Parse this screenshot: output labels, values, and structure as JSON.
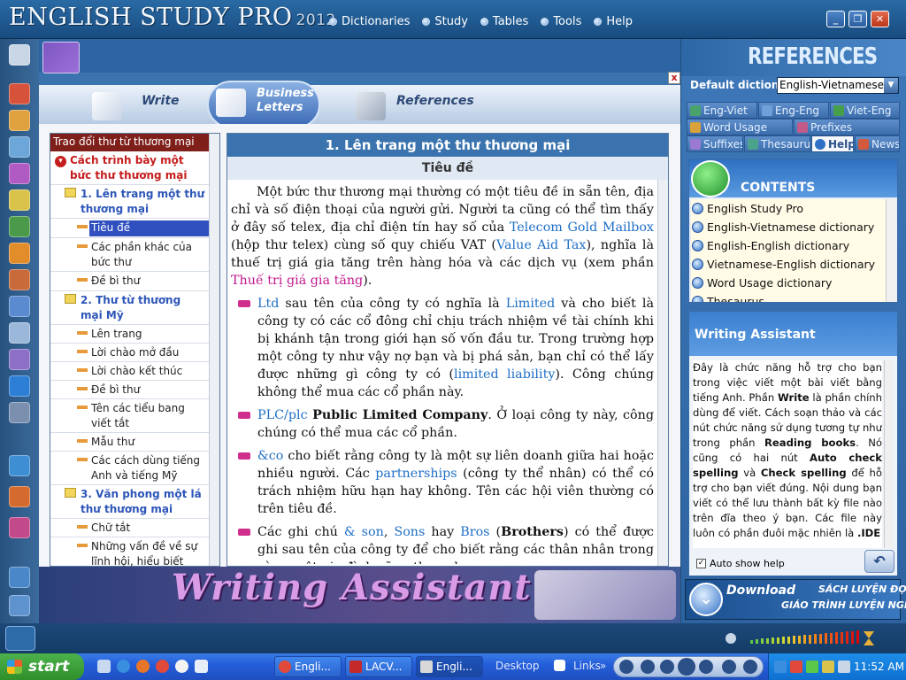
{
  "app": {
    "title": "ENGLISH STUDY PRO",
    "year": "2012",
    "menu": [
      "Dictionaries",
      "Study",
      "Tables",
      "Tools",
      "Help"
    ]
  },
  "window_buttons": {
    "minimize": "_",
    "restore": "❐",
    "close": "✕"
  },
  "tabs": {
    "write": "Write",
    "business_line1": "Business",
    "business_line2": "Letters",
    "references": "References"
  },
  "tree": {
    "header": "Trao đổi thư từ thương mại",
    "items": [
      "Cách trình bày một bức thư thương mại",
      "1. Lên trang một thư thương mại",
      "Tiêu đề",
      "Các phần khác của bức thư",
      "Đề bì thư",
      "2. Thư từ thương mại Mỹ",
      "Lên trang",
      "Lời chào mở đầu",
      "Lời chào kết thúc",
      "Đề bì thư",
      "Tên các tiểu bang viết tắt",
      "Mẫu thư",
      "Các cách dùng tiếng Anh và tiếng Mỹ",
      "3. Văn phong một lá thư thương mại",
      "Chữ tắt",
      "Những vấn đề về sự lĩnh hội, hiểu biết"
    ]
  },
  "article": {
    "title": "1. Lên trang một thư thương mại",
    "subtitle": "Tiêu đề",
    "p1": [
      "Một bức thư thương mại thường có một tiêu đề in sẵn tên, địa chỉ và số điện thoại của người gửi. Người ta cũng có thể tìm thấy ở đây số telex, địa chỉ điện tín hay số của ",
      "Telecom Gold Mailbox",
      " (hộp thư telex) cùng số quy chiếu VAT (",
      "Value Aid Tax",
      "), nghĩa là thuế trị giá gia tăng trên hàng hóa và các dịch vụ (xem phần ",
      "Thuế trị giá gia tăng",
      ")."
    ],
    "b1": [
      "Ltd",
      " sau tên của công ty có nghĩa là ",
      "Limited",
      " và cho biết là công ty có các cổ đông chỉ chịu trách nhiệm về tài chính khi bị khánh tận trong giới hạn số vốn đầu tư. Trong trường hợp một công ty như vậy nợ bạn và bị phá sản, bạn chỉ có thể lấy được những gì công ty có (",
      "limited liability",
      "). Công chúng không thể mua các cổ phần này."
    ],
    "b2": [
      "PLC/plc",
      " ",
      "Public Limited Company",
      ". Ở loại công ty này, công chúng có thể mua các cổ phần."
    ],
    "b3": [
      "&co",
      " cho biết rằng công ty là một sự liên doanh giữa hai hoặc nhiều người. Các ",
      "partnerships",
      " (công ty thể nhân) có thể có trách nhiệm hữu hạn hay không. Tên các hội viên thường có trên tiêu đề."
    ],
    "b4": [
      "Các ghi chú ",
      "& son",
      ", ",
      "Sons",
      " hay ",
      "Bros",
      " (",
      "Brothers",
      ") có thể được ghi sau tên của công ty để cho biết rằng các thân nhân trong cùng một gia đình cũng tham dự."
    ]
  },
  "banner": "Writing Assistant",
  "references": {
    "title": "REFERENCES",
    "default_dict_label": "Default dictionary:",
    "default_dict_value": "English-Vietnamese",
    "tabs": [
      "Eng-Viet",
      "Eng-Eng",
      "Viet-Eng",
      "Word Usage",
      "Prefixes",
      "Suffixes",
      "Thesaurus",
      "Help",
      "News"
    ],
    "contents_title": "CONTENTS",
    "contents": [
      "English Study Pro",
      "English-Vietnamese dictionary",
      "English-English dictionary",
      "Vietnamese-English dictionary",
      "Word Usage dictionary",
      "Thesaurus"
    ],
    "wa_title": "Writing Assistant",
    "wa_text": [
      "Đây là chức năng hỗ trợ cho bạn trong việc viết một bài viết bằng tiếng Anh. Phần ",
      "Write",
      " là phần chính dùng để viết. Cách soạn thảo và các nút chức năng sử dụng tương tự như trong phần ",
      "Reading books",
      ". Nó cũng có hai nút ",
      "Auto check spelling",
      " và ",
      "Check spelling",
      " để hỗ trợ cho bạn viết đúng. Nội dung bạn viết có thể lưu thành bất kỳ file nào trên đĩa theo ý bạn. Các file này luôn có phần đuôi mặc nhiên là ",
      ".IDE",
      ""
    ],
    "auto_show_help": "Auto show help",
    "download": "Download",
    "download_r1": "SÁCH LUYỆN ĐỌC",
    "download_r2": "GIÁO TRÌNH LUYỆN NGHE"
  },
  "taskbar": {
    "start": "start",
    "tasks": [
      "Engli...",
      "LACV...",
      "Engli..."
    ],
    "desktop": "Desktop",
    "links": "Links",
    "clock": "11:52 AM"
  },
  "colors": {
    "accent": "#3a73ad",
    "tree_header": "#7e1f1a",
    "link": "#1f6fc5",
    "pink": "#c2188e",
    "banner_text": "#d99be6"
  }
}
